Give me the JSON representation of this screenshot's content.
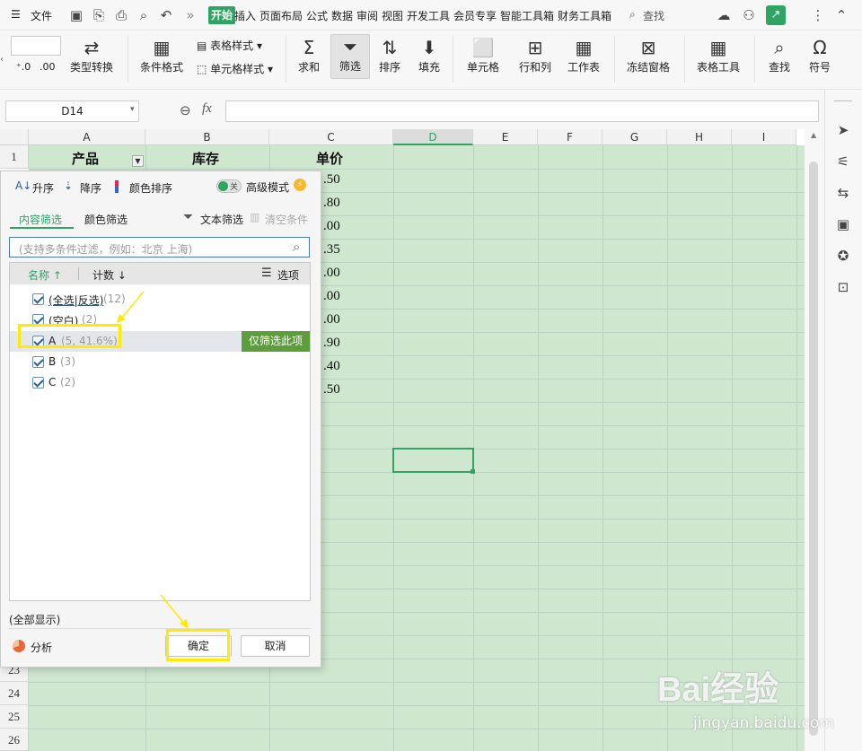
{
  "menubar": {
    "file": "文件",
    "tabs": [
      "开始",
      "插入",
      "页面布局",
      "公式",
      "数据",
      "审阅",
      "视图",
      "开发工具",
      "会员专享",
      "智能工具箱",
      "财务工具箱"
    ],
    "search": "查找"
  },
  "ribbon": {
    "type_convert": "类型转换",
    "cond_format": "条件格式",
    "table_style": "表格样式",
    "cell_style": "单元格样式",
    "sum": "求和",
    "filter": "筛选",
    "sort": "排序",
    "fill": "填充",
    "cell": "单元格",
    "row_col": "行和列",
    "sheet": "工作表",
    "freeze": "冻结窗格",
    "table_tools": "表格工具",
    "find": "查找",
    "symbol": "符号"
  },
  "formula_bar": {
    "cell_ref": "D14",
    "fx": "fx",
    "content": ""
  },
  "grid": {
    "columns": [
      "A",
      "B",
      "C",
      "D",
      "E",
      "F",
      "G",
      "H",
      "I"
    ],
    "rows_visible_top": [
      "1"
    ],
    "rows_visible_bottom": [
      "23",
      "24",
      "25",
      "26"
    ],
    "headers": {
      "A1": "产品",
      "B1": "库存",
      "C1": "单价"
    },
    "c_values": [
      ".50",
      ".80",
      ".00",
      ".35",
      ".00",
      ".00",
      ".00",
      ".90",
      ".40",
      ".50"
    ],
    "selected_cell": "D14"
  },
  "filter_popup": {
    "asc": "升序",
    "desc": "降序",
    "color_sort": "颜色排序",
    "toggle_off": "关",
    "advanced_mode": "高级模式",
    "tab_content": "内容筛选",
    "tab_color": "颜色筛选",
    "text_filter": "文本筛选",
    "clear_cond": "清空条件",
    "search_placeholder": "(支持多条件过滤，例如：北京  上海)",
    "col_name": "名称",
    "col_count": "计数",
    "options": "选项",
    "items": [
      {
        "label": "(全选|反选)",
        "count": "(12)",
        "checked": true
      },
      {
        "label": "(空白)",
        "count": "(2)",
        "checked": true
      },
      {
        "label": "A",
        "count": "(5, 41.6%)",
        "checked": true
      },
      {
        "label": "B",
        "count": "(3)",
        "checked": true
      },
      {
        "label": "C",
        "count": "(2)",
        "checked": true
      }
    ],
    "only_filter_this": "仅筛选此项",
    "show_all": "(全部显示)",
    "analysis": "分析",
    "ok": "确定",
    "cancel": "取消"
  },
  "watermark": {
    "brand": "Bai经验",
    "url": "jingyan.baidu.com"
  },
  "colors": {
    "accent": "#2fa463",
    "cell_bg": "#cfe6cf",
    "highlight": "#ffea00",
    "only_filter_bg": "#5e9d3c"
  }
}
